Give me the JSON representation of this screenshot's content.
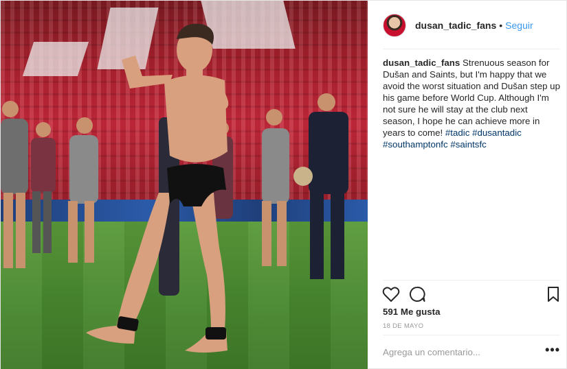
{
  "photo": {
    "alt": "Dušan Tadić celebrating on the pitch"
  },
  "header": {
    "username": "dusan_tadic_fans",
    "separator": "•",
    "follow_label": "Seguir"
  },
  "caption": {
    "username": "dusan_tadic_fans",
    "text": " Strenuous season for Dušan and Saints, but I'm happy that we avoid the worst situation and Dušan step up his game before World Cup. Although I'm not sure he will stay at the club next season, I hope he can achieve more in years to come! ",
    "hashtags": [
      "#tadic",
      "#dusantadic",
      "#southamptonfc",
      "#saintsfc"
    ]
  },
  "actions": {
    "like_icon": "heart-icon",
    "comment_icon": "speech-bubble-icon",
    "save_icon": "bookmark-icon"
  },
  "likes": "591 Me gusta",
  "date": "18 DE MAYO",
  "comment": {
    "placeholder": "Agrega un comentario...",
    "more_label": "•••"
  },
  "colors": {
    "link_blue": "#3897f0",
    "hashtag_blue": "#003569",
    "muted_gray": "#999999",
    "text": "#262626"
  }
}
